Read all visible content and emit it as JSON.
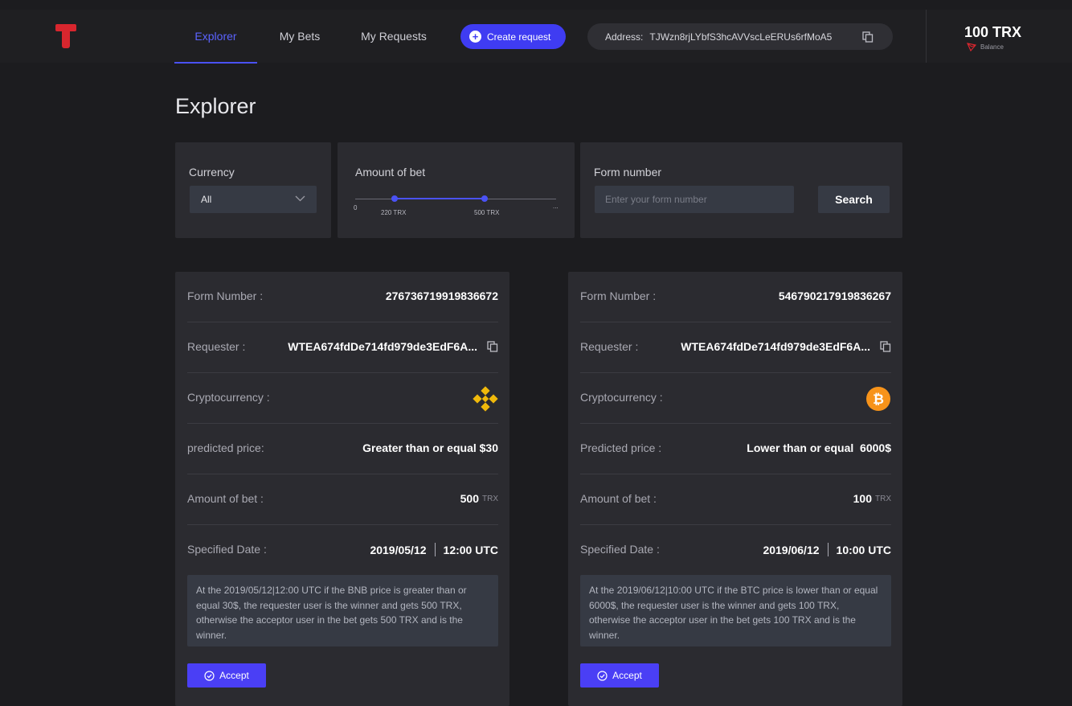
{
  "header": {
    "tabs": [
      {
        "label": "Explorer",
        "active": true
      },
      {
        "label": "My Bets",
        "active": false
      },
      {
        "label": "My Requests",
        "active": false
      }
    ],
    "create_label": "Create request",
    "address_label": "Address:",
    "address_value": "TJWzn8rjLYbfS3hcAVVscLeERUs6rfMoA5",
    "balance_amount": "100 TRX",
    "balance_label": "Balance"
  },
  "page": {
    "title": "Explorer"
  },
  "filters": {
    "currency_label": "Currency",
    "currency_value": "All",
    "amount_label": "Amount of bet",
    "slider_min": "0",
    "slider_low": "220 TRX",
    "slider_high": "500 TRX",
    "slider_max": "...",
    "form_number_label": "Form number",
    "form_number_placeholder": "Enter your form number",
    "search_label": "Search"
  },
  "cards": [
    {
      "form_number_key": "Form Number :",
      "form_number": "276736719919836672",
      "requester_key": "Requester :",
      "requester": "WTEA674fdDe714fd979de3EdF6A...",
      "crypto_key": "Cryptocurrency :",
      "crypto_icon": "bnb-icon",
      "predicted_key": "predicted price:",
      "predicted": "Greater than or equal $30",
      "amount_key": "Amount of bet :",
      "amount": "500",
      "amount_unit": "TRX",
      "date_key": "Specified Date :",
      "date": "2019/05/12",
      "time": "12:00 UTC",
      "description": "At the 2019/05/12|12:00 UTC  if the  BNB price is greater than or equal 30$, the requester user is the winner and gets 500 TRX, otherwise the acceptor user in the bet gets 500 TRX and  is the winner.",
      "accept_label": "Accept"
    },
    {
      "form_number_key": "Form Number :",
      "form_number": "546790217919836267",
      "requester_key": "Requester :",
      "requester": "WTEA674fdDe714fd979de3EdF6A...",
      "crypto_key": "Cryptocurrency :",
      "crypto_icon": "bitcoin-icon",
      "predicted_key": "Predicted price :",
      "predicted": "Lower than or equal  6000$",
      "amount_key": "Amount of bet :",
      "amount": "100",
      "amount_unit": "TRX",
      "date_key": "Specified Date :",
      "date": "2019/06/12",
      "time": "10:00 UTC",
      "description": "At the 2019/06/12|10:00 UTC  if the  BTC price is lower than or equal 6000$, the requester user is the winner and gets 100 TRX, otherwise the acceptor user in the bet gets 100 TRX and  is the winner.",
      "accept_label": "Accept"
    }
  ],
  "colors": {
    "accent": "#4a52f5",
    "brand_red": "#d8262e",
    "bnb": "#f0b90b",
    "btc": "#f7931a"
  }
}
